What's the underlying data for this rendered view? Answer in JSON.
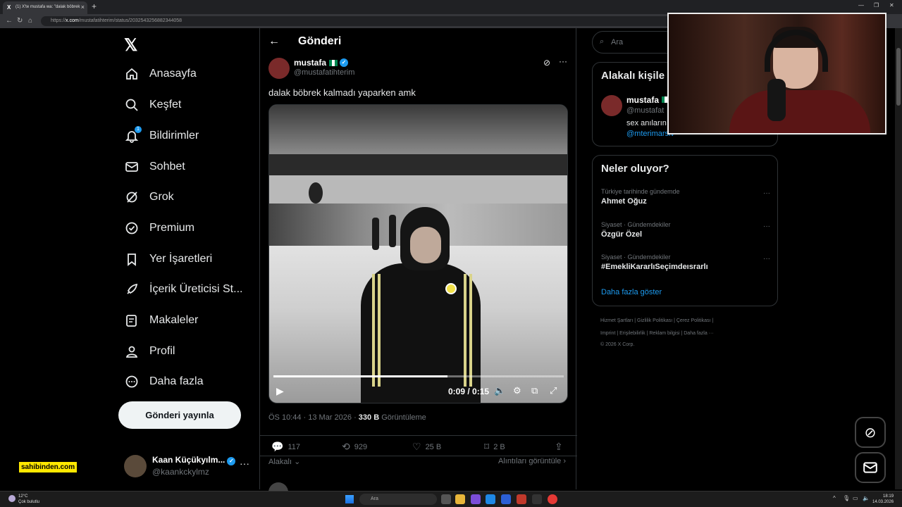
{
  "browser": {
    "tab_title": "(1) X'te mustafa wa: \"dalak böbrek",
    "url_domain": "x.com",
    "url_path": "/mustafatihterim/status/2032543256882344058",
    "url_prefix": "https://"
  },
  "nav": {
    "logo": "𝕏",
    "items": [
      {
        "label": "Anasayfa",
        "icon": "home-icon"
      },
      {
        "label": "Keşfet",
        "icon": "search-icon"
      },
      {
        "label": "Bildirimler",
        "icon": "bell-icon",
        "badge": "1"
      },
      {
        "label": "Sohbet",
        "icon": "envelope-icon"
      },
      {
        "label": "Grok",
        "icon": "grok-icon"
      },
      {
        "label": "Premium",
        "icon": "premium-icon"
      },
      {
        "label": "Yer İşaretleri",
        "icon": "bookmark-icon"
      },
      {
        "label": "İçerik Üreticisi St...",
        "icon": "rocket-icon"
      },
      {
        "label": "Makaleler",
        "icon": "article-icon"
      },
      {
        "label": "Profil",
        "icon": "profile-icon"
      },
      {
        "label": "Daha fazla",
        "icon": "more-circle-icon"
      }
    ],
    "post_button": "Gönderi yayınla",
    "account": {
      "name": "Kaan Küçükyılm...",
      "handle": "@kaankckylmz"
    }
  },
  "main": {
    "title": "Gönderi",
    "tweet": {
      "name": "mustafa",
      "handle": "@mustafatihterim",
      "text": "dalak böbrek kalmadı yaparken amk",
      "video": {
        "current": "0:09",
        "duration": "0:15",
        "progress": 0.6
      },
      "time": "ÖS 10:44 · 13 Mar 2026 · ",
      "views": "330 B",
      "views_label": " Görüntüleme",
      "replies": "117",
      "retweets": "929",
      "likes": "25 B",
      "bookmarks": "2 B"
    },
    "relevance": "Alakalı",
    "quotes": "Alıntıları görüntüle"
  },
  "right": {
    "search_placeholder": "Ara",
    "related_title": "Alakalı kişile",
    "related_person": {
      "name": "mustafa",
      "handle": "@mustafat",
      "bio": "sex anıların",
      "link": "@mterimarsiv"
    },
    "trends_title": "Neler oluyor?",
    "trends": [
      {
        "context": "Türkiye tarihinde gündemde",
        "name": "Ahmet Oğuz"
      },
      {
        "context": "Siyaset · Gündemdekiler",
        "name": "Özgür Özel"
      },
      {
        "context": "Siyaset · Gündemdekiler",
        "name": "#EmekliKararlıSeçimdeısrarlı"
      }
    ],
    "show_more": "Daha fazla göster",
    "footer_line1": "Hizmet Şartları  |  Gizlilik Politikası  |  Çerez Politikası  |",
    "footer_line2": "Imprint  |  Erişilebilirlik  |  Reklam bilgisi  |  Daha fazla ···",
    "footer_line3": "© 2026 X Corp."
  },
  "overlay": {
    "sponsor": "sahibinden.com"
  },
  "taskbar": {
    "temp": "12°C",
    "weather": "Çok bulutlu",
    "search": "Ara",
    "time": "18:19",
    "date": "14.03.2026"
  }
}
